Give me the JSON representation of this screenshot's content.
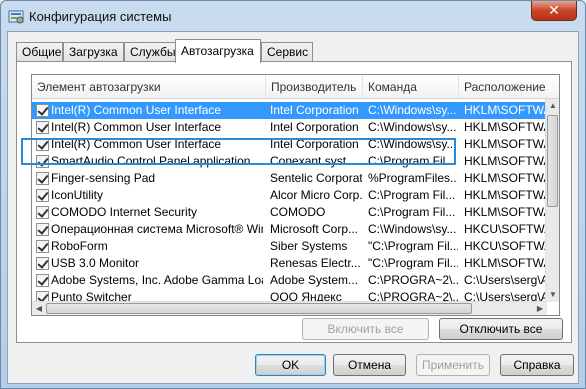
{
  "window": {
    "title": "Конфигурация системы",
    "close_label": "✕"
  },
  "tabs": [
    {
      "label": "Общие"
    },
    {
      "label": "Загрузка"
    },
    {
      "label": "Службы"
    },
    {
      "label": "Автозагрузка"
    },
    {
      "label": "Сервис"
    }
  ],
  "columns": [
    "Элемент автозагрузки",
    "Производитель",
    "Команда",
    "Расположение"
  ],
  "rows": [
    {
      "name": "Intel(R) Common User Interface",
      "maker": "Intel Corporation",
      "command": "C:\\Windows\\sy...",
      "location": "HKLM\\SOFTWAR"
    },
    {
      "name": "Intel(R) Common User Interface",
      "maker": "Intel Corporation",
      "command": "C:\\Windows\\sy...",
      "location": "HKLM\\SOFTWAR"
    },
    {
      "name": "Intel(R) Common User Interface",
      "maker": "Intel Corporation",
      "command": "C:\\Windows\\sy...",
      "location": "HKLM\\SOFTWAR"
    },
    {
      "name": "SmartAudio Control Panel application",
      "maker": "Conexant syst...",
      "command": "C:\\Program Fil...",
      "location": "HKLM\\SOFTWAR"
    },
    {
      "name": "Finger-sensing Pad",
      "maker": "Sentelic Corporation",
      "command": "%ProgramFiles...",
      "location": "HKLM\\SOFTWAR"
    },
    {
      "name": "IconUtility",
      "maker": "Alcor Micro Corp.",
      "command": "C:\\Program Fil...",
      "location": "HKLM\\SOFTWAR"
    },
    {
      "name": "COMODO Internet Security",
      "maker": "COMODO",
      "command": "C:\\Program Fil...",
      "location": "HKLM\\SOFTWAR"
    },
    {
      "name": "Операционная система Microsoft® Win...",
      "maker": "Microsoft Corp...",
      "command": "C:\\Windows\\sy...",
      "location": "HKCU\\SOFTWAR"
    },
    {
      "name": "RoboForm",
      "maker": "Siber Systems",
      "command": "\"C:\\Program Fil...",
      "location": "HKCU\\SOFTWAR"
    },
    {
      "name": "USB 3.0 Monitor",
      "maker": "Renesas Electr...",
      "command": "\"C:\\Program Fil...",
      "location": "HKLM\\SOFTWAR"
    },
    {
      "name": "Adobe Systems, Inc. Adobe Gamma Loader",
      "maker": "Adobe System...",
      "command": "C:\\PROGRA~2\\...",
      "location": "C:\\Users\\serg\\A"
    },
    {
      "name": "Punto Switcher",
      "maker": "ООО Яндекс",
      "command": "C:\\PROGRA~2\\...",
      "location": "C:\\Users\\serg\\A"
    }
  ],
  "buttons": {
    "enable_all": "Включить все",
    "disable_all": "Отключить все",
    "ok": "OK",
    "cancel": "Отмена",
    "apply": "Применить",
    "help": "Справка"
  }
}
